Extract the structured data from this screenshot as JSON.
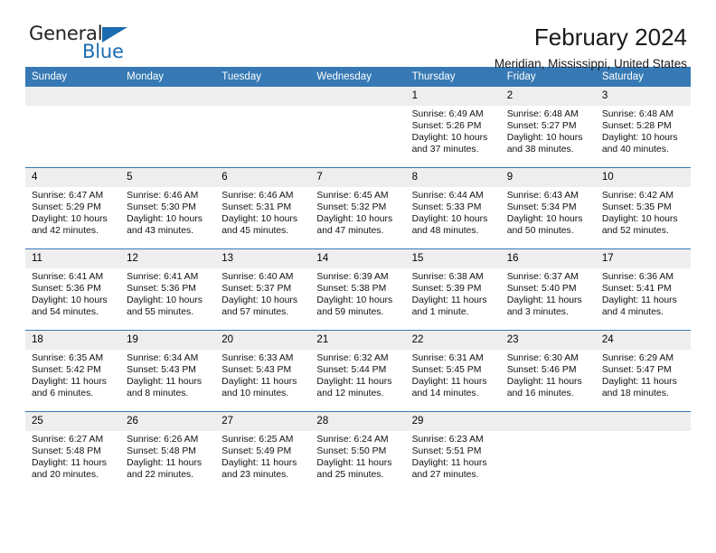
{
  "brand": {
    "word1": "General",
    "word2": "Blue",
    "triangle_icon": "brand-triangle-icon",
    "color_dark": "#231f20",
    "color_blue": "#1b6cb0"
  },
  "header": {
    "title": "February 2024",
    "subtitle": "Meridian, Mississippi, United States"
  },
  "theme": {
    "header_bg": "#3679b4",
    "header_text": "#ffffff",
    "daynum_bg": "#eeeeee",
    "cell_bg": "#ffffff",
    "separator": "#3679b4"
  },
  "weekday_headers": [
    "Sunday",
    "Monday",
    "Tuesday",
    "Wednesday",
    "Thursday",
    "Friday",
    "Saturday"
  ],
  "labels": {
    "sunrise": "Sunrise:",
    "sunset": "Sunset:",
    "daylight": "Daylight:"
  },
  "weeks": [
    [
      {
        "empty": true
      },
      {
        "empty": true
      },
      {
        "empty": true
      },
      {
        "empty": true
      },
      {
        "day": "1",
        "sunrise": "Sunrise: 6:49 AM",
        "sunset": "Sunset: 5:26 PM",
        "daylight1": "Daylight: 10 hours",
        "daylight2": "and 37 minutes."
      },
      {
        "day": "2",
        "sunrise": "Sunrise: 6:48 AM",
        "sunset": "Sunset: 5:27 PM",
        "daylight1": "Daylight: 10 hours",
        "daylight2": "and 38 minutes."
      },
      {
        "day": "3",
        "sunrise": "Sunrise: 6:48 AM",
        "sunset": "Sunset: 5:28 PM",
        "daylight1": "Daylight: 10 hours",
        "daylight2": "and 40 minutes."
      }
    ],
    [
      {
        "day": "4",
        "sunrise": "Sunrise: 6:47 AM",
        "sunset": "Sunset: 5:29 PM",
        "daylight1": "Daylight: 10 hours",
        "daylight2": "and 42 minutes."
      },
      {
        "day": "5",
        "sunrise": "Sunrise: 6:46 AM",
        "sunset": "Sunset: 5:30 PM",
        "daylight1": "Daylight: 10 hours",
        "daylight2": "and 43 minutes."
      },
      {
        "day": "6",
        "sunrise": "Sunrise: 6:46 AM",
        "sunset": "Sunset: 5:31 PM",
        "daylight1": "Daylight: 10 hours",
        "daylight2": "and 45 minutes."
      },
      {
        "day": "7",
        "sunrise": "Sunrise: 6:45 AM",
        "sunset": "Sunset: 5:32 PM",
        "daylight1": "Daylight: 10 hours",
        "daylight2": "and 47 minutes."
      },
      {
        "day": "8",
        "sunrise": "Sunrise: 6:44 AM",
        "sunset": "Sunset: 5:33 PM",
        "daylight1": "Daylight: 10 hours",
        "daylight2": "and 48 minutes."
      },
      {
        "day": "9",
        "sunrise": "Sunrise: 6:43 AM",
        "sunset": "Sunset: 5:34 PM",
        "daylight1": "Daylight: 10 hours",
        "daylight2": "and 50 minutes."
      },
      {
        "day": "10",
        "sunrise": "Sunrise: 6:42 AM",
        "sunset": "Sunset: 5:35 PM",
        "daylight1": "Daylight: 10 hours",
        "daylight2": "and 52 minutes."
      }
    ],
    [
      {
        "day": "11",
        "sunrise": "Sunrise: 6:41 AM",
        "sunset": "Sunset: 5:36 PM",
        "daylight1": "Daylight: 10 hours",
        "daylight2": "and 54 minutes."
      },
      {
        "day": "12",
        "sunrise": "Sunrise: 6:41 AM",
        "sunset": "Sunset: 5:36 PM",
        "daylight1": "Daylight: 10 hours",
        "daylight2": "and 55 minutes."
      },
      {
        "day": "13",
        "sunrise": "Sunrise: 6:40 AM",
        "sunset": "Sunset: 5:37 PM",
        "daylight1": "Daylight: 10 hours",
        "daylight2": "and 57 minutes."
      },
      {
        "day": "14",
        "sunrise": "Sunrise: 6:39 AM",
        "sunset": "Sunset: 5:38 PM",
        "daylight1": "Daylight: 10 hours",
        "daylight2": "and 59 minutes."
      },
      {
        "day": "15",
        "sunrise": "Sunrise: 6:38 AM",
        "sunset": "Sunset: 5:39 PM",
        "daylight1": "Daylight: 11 hours",
        "daylight2": "and 1 minute."
      },
      {
        "day": "16",
        "sunrise": "Sunrise: 6:37 AM",
        "sunset": "Sunset: 5:40 PM",
        "daylight1": "Daylight: 11 hours",
        "daylight2": "and 3 minutes."
      },
      {
        "day": "17",
        "sunrise": "Sunrise: 6:36 AM",
        "sunset": "Sunset: 5:41 PM",
        "daylight1": "Daylight: 11 hours",
        "daylight2": "and 4 minutes."
      }
    ],
    [
      {
        "day": "18",
        "sunrise": "Sunrise: 6:35 AM",
        "sunset": "Sunset: 5:42 PM",
        "daylight1": "Daylight: 11 hours",
        "daylight2": "and 6 minutes."
      },
      {
        "day": "19",
        "sunrise": "Sunrise: 6:34 AM",
        "sunset": "Sunset: 5:43 PM",
        "daylight1": "Daylight: 11 hours",
        "daylight2": "and 8 minutes."
      },
      {
        "day": "20",
        "sunrise": "Sunrise: 6:33 AM",
        "sunset": "Sunset: 5:43 PM",
        "daylight1": "Daylight: 11 hours",
        "daylight2": "and 10 minutes."
      },
      {
        "day": "21",
        "sunrise": "Sunrise: 6:32 AM",
        "sunset": "Sunset: 5:44 PM",
        "daylight1": "Daylight: 11 hours",
        "daylight2": "and 12 minutes."
      },
      {
        "day": "22",
        "sunrise": "Sunrise: 6:31 AM",
        "sunset": "Sunset: 5:45 PM",
        "daylight1": "Daylight: 11 hours",
        "daylight2": "and 14 minutes."
      },
      {
        "day": "23",
        "sunrise": "Sunrise: 6:30 AM",
        "sunset": "Sunset: 5:46 PM",
        "daylight1": "Daylight: 11 hours",
        "daylight2": "and 16 minutes."
      },
      {
        "day": "24",
        "sunrise": "Sunrise: 6:29 AM",
        "sunset": "Sunset: 5:47 PM",
        "daylight1": "Daylight: 11 hours",
        "daylight2": "and 18 minutes."
      }
    ],
    [
      {
        "day": "25",
        "sunrise": "Sunrise: 6:27 AM",
        "sunset": "Sunset: 5:48 PM",
        "daylight1": "Daylight: 11 hours",
        "daylight2": "and 20 minutes."
      },
      {
        "day": "26",
        "sunrise": "Sunrise: 6:26 AM",
        "sunset": "Sunset: 5:48 PM",
        "daylight1": "Daylight: 11 hours",
        "daylight2": "and 22 minutes."
      },
      {
        "day": "27",
        "sunrise": "Sunrise: 6:25 AM",
        "sunset": "Sunset: 5:49 PM",
        "daylight1": "Daylight: 11 hours",
        "daylight2": "and 23 minutes."
      },
      {
        "day": "28",
        "sunrise": "Sunrise: 6:24 AM",
        "sunset": "Sunset: 5:50 PM",
        "daylight1": "Daylight: 11 hours",
        "daylight2": "and 25 minutes."
      },
      {
        "day": "29",
        "sunrise": "Sunrise: 6:23 AM",
        "sunset": "Sunset: 5:51 PM",
        "daylight1": "Daylight: 11 hours",
        "daylight2": "and 27 minutes."
      },
      {
        "empty": true
      },
      {
        "empty": true
      }
    ]
  ]
}
